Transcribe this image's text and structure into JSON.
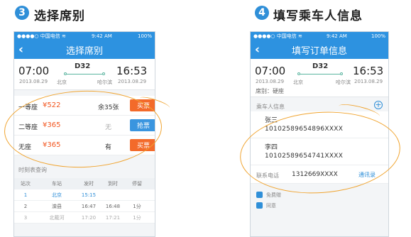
{
  "left": {
    "step_number": "3",
    "step_title": "选择席别",
    "status": {
      "carrier": "●●●●○ 中国电信 ≋",
      "time": "9:42 AM",
      "battery": "100%"
    },
    "nav_title": "选择席别",
    "train": {
      "depart_time": "07:00",
      "arrive_time": "16:53",
      "train_no": "D32",
      "depart_date": "2013.08.29",
      "arrive_date": "2013.08.29",
      "from": "北京",
      "to": "哈尔滨"
    },
    "seats": [
      {
        "name": "一等座",
        "price": "¥522",
        "remain": "余35张",
        "action": "买票",
        "action_type": "buy"
      },
      {
        "name": "二等座",
        "price": "¥365",
        "remain": "无",
        "action": "抢票",
        "action_type": "grab"
      },
      {
        "name": "无座",
        "price": "¥365",
        "remain": "有",
        "action": "买票",
        "action_type": "buy"
      }
    ],
    "schedule_label": "时刻表查询",
    "schedule_headers": [
      "站次",
      "车站",
      "发时",
      "到时",
      "停留"
    ],
    "schedule_rows": [
      [
        "1",
        "北京",
        "15:15",
        "",
        ""
      ],
      [
        "2",
        "滦县",
        "16:47",
        "16:48",
        "1分"
      ],
      [
        "3",
        "北戴河",
        "17:20",
        "17:21",
        "1分"
      ]
    ]
  },
  "right": {
    "step_number": "4",
    "step_title": "填写乘车人信息",
    "status": {
      "carrier": "●●●●○ 中国电信 ≋",
      "time": "9:42 AM",
      "battery": "100%"
    },
    "nav_title": "填写订单信息",
    "train": {
      "depart_time": "07:00",
      "arrive_time": "16:53",
      "train_no": "D32",
      "depart_date": "2013.08.29",
      "arrive_date": "2013.08.29",
      "from": "北京",
      "to": "哈尔滨"
    },
    "seat_class": "席别：硬座",
    "passenger_label": "乘车人信息",
    "passengers": [
      {
        "name": "张三",
        "id": "10102589654896XXXX"
      },
      {
        "name": "李四",
        "id": "10102589654741XXXX"
      }
    ],
    "contact_label": "联系电话",
    "contact_value": "1312669XXXX",
    "contact_book": "通讯录",
    "checks": [
      "免费赠",
      "同意"
    ]
  },
  "colors": {
    "accent": "#2d92e0",
    "buy": "#f36a2a",
    "grab": "#3a95df",
    "price": "#f2551e",
    "annotation": "#f0a430"
  }
}
